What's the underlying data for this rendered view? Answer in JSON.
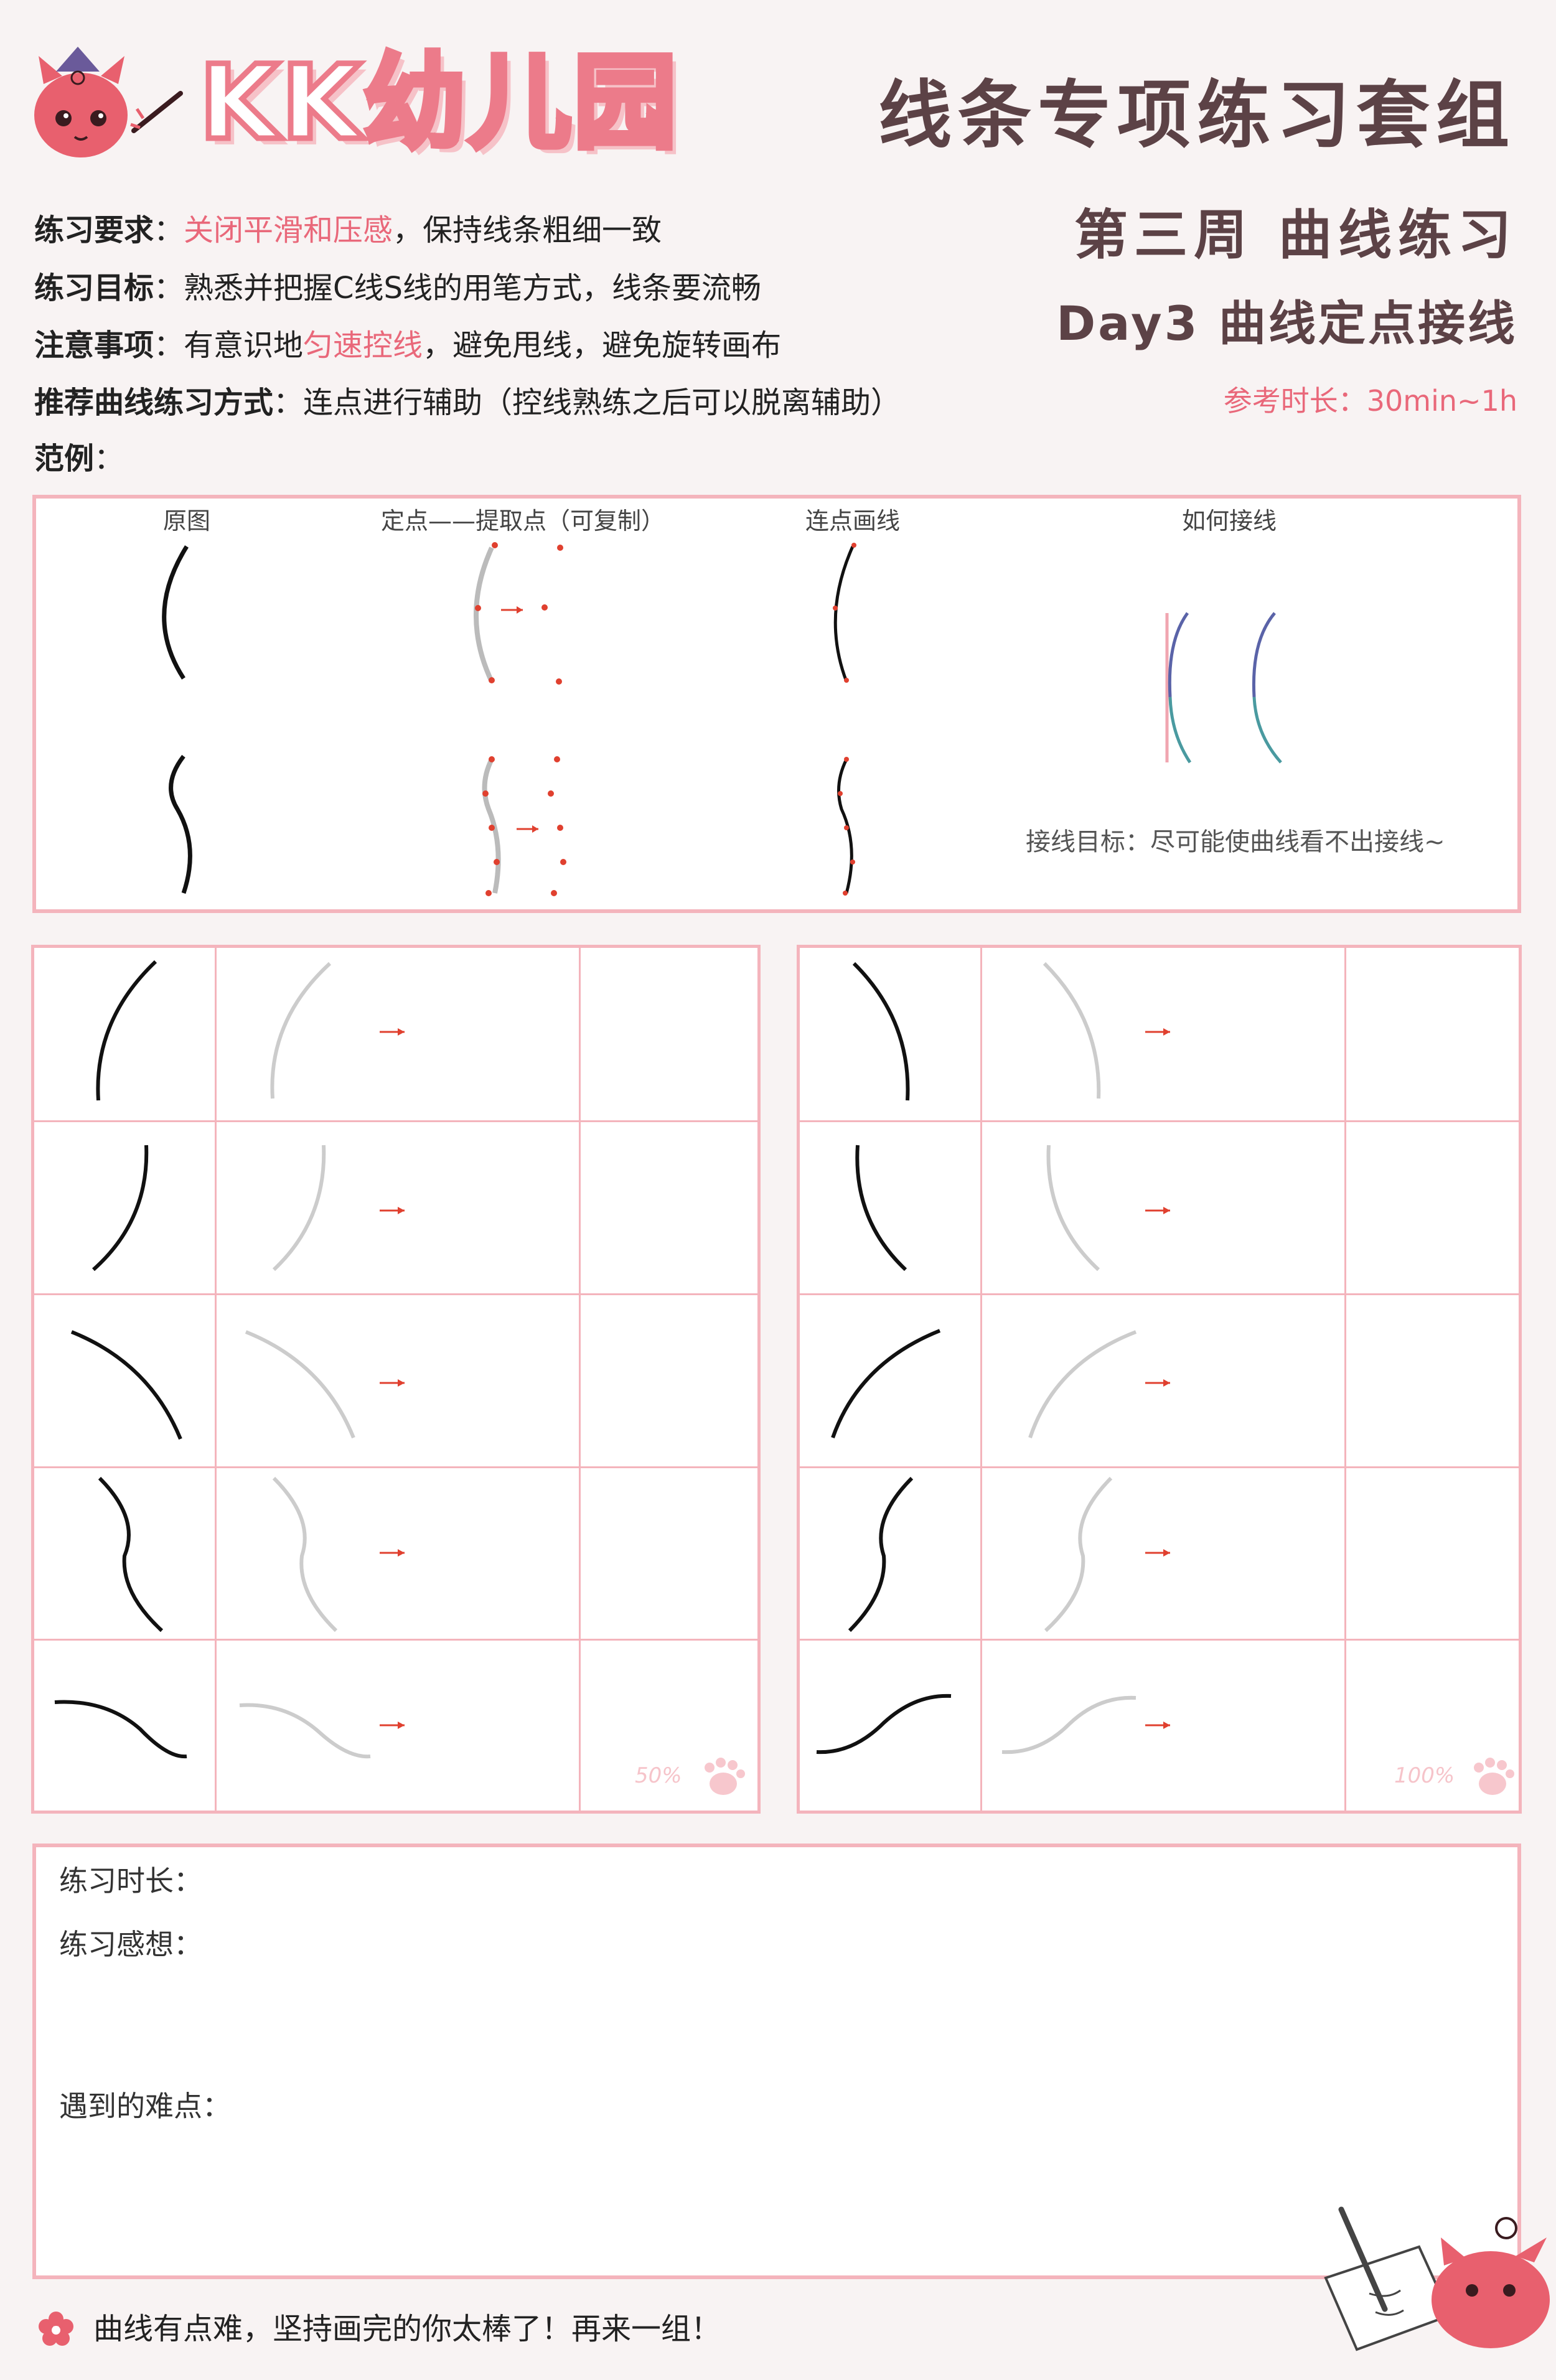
{
  "header": {
    "logo_text": "KK幼儿园",
    "title": "线条专项练习套组"
  },
  "requirements": [
    {
      "label": "练习要求",
      "sep": "：",
      "segments": [
        {
          "text": "关闭平滑和压感",
          "hl": true
        },
        {
          "text": "，保持线条粗细一致",
          "hl": false
        }
      ]
    },
    {
      "label": "练习目标",
      "sep": "：",
      "segments": [
        {
          "text": "熟悉并把握C线S线的用笔方式，线条要流畅",
          "hl": false
        }
      ]
    },
    {
      "label": "注意事项",
      "sep": "：",
      "segments": [
        {
          "text": "有意识地",
          "hl": false
        },
        {
          "text": "匀速控线",
          "hl": true
        },
        {
          "text": "，避免甩线，避免旋转画布",
          "hl": false
        }
      ]
    },
    {
      "label": "推荐曲线练习方式",
      "sep": "：",
      "segments": [
        {
          "text": "连点进行辅助（控线熟练之后可以脱离辅助）",
          "hl": false
        }
      ]
    },
    {
      "label": "范例",
      "sep": "：",
      "segments": []
    }
  ],
  "week_title": "第三周 曲线练习",
  "day_title": "Day3 曲线定点接线",
  "ref_time": "参考时长：30min~1h",
  "example": {
    "col_labels": [
      "原图",
      "定点——提取点（可复制）",
      "连点画线",
      "如何接线"
    ],
    "note": "接线目标：尽可能使曲线看不出接线~"
  },
  "practice": {
    "left_percent": "50%",
    "right_percent": "100%"
  },
  "bottom": {
    "duration_label": "练习时长：",
    "thoughts_label": "练习感想：",
    "difficulty_label": "遇到的难点："
  },
  "footer": "曲线有点难，坚持画完的你太棒了！再来一组！",
  "colors": {
    "accent": "#e9687a",
    "frame": "#f4b4bc",
    "title": "#5c4246",
    "mascot": "#e8606e"
  }
}
